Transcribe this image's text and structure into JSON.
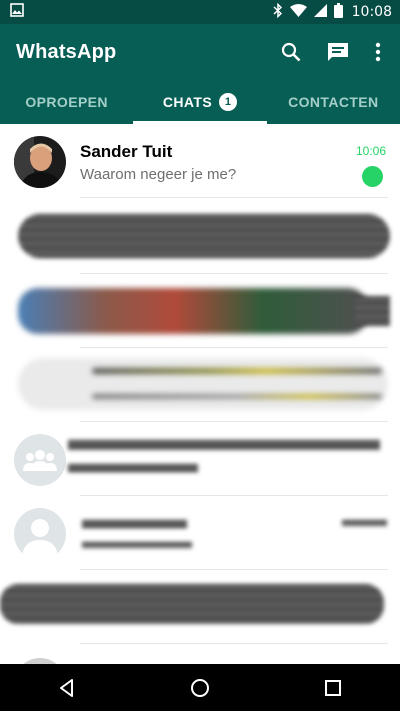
{
  "status_bar": {
    "time": "10:08",
    "icons": [
      "image-icon",
      "bluetooth-icon",
      "wifi-icon",
      "signal-icon",
      "battery-icon"
    ]
  },
  "app": {
    "title": "WhatsApp",
    "accent_color": "#075e54",
    "actions": [
      "search-icon",
      "new-chat-icon",
      "more-options-icon"
    ]
  },
  "tabs": [
    {
      "label": "OPROEPEN",
      "active": false
    },
    {
      "label": "CHATS",
      "active": true,
      "badge": "1"
    },
    {
      "label": "CONTACTEN",
      "active": false
    }
  ],
  "chats": [
    {
      "name": "Sander Tuit",
      "last_message": "Waarom negeer je me?",
      "time": "10:06",
      "unread": true,
      "unread_color": "#25d366"
    }
  ],
  "nav_bar": {
    "buttons": [
      "back-icon",
      "home-icon",
      "recents-icon"
    ]
  }
}
